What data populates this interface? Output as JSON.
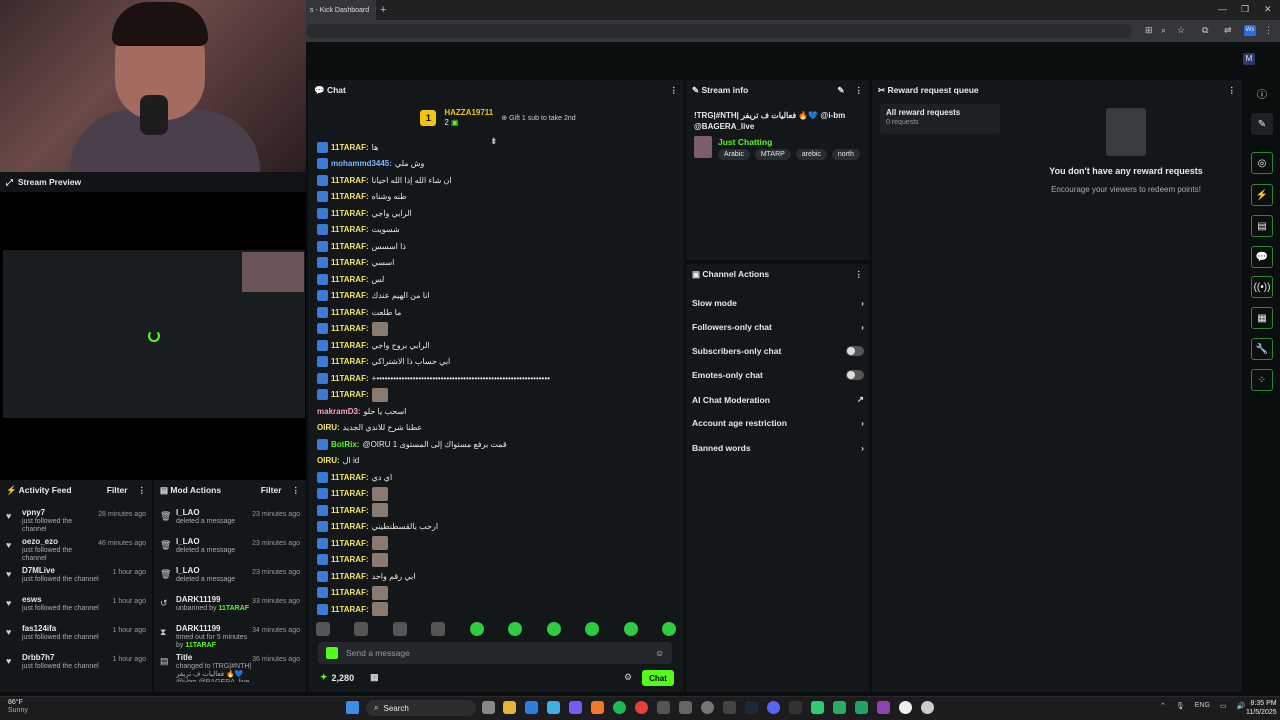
{
  "browser": {
    "tab_title": "s - Kick Dashboard",
    "tab_close": "×",
    "new_tab": "+",
    "window_controls": [
      "—",
      "❐",
      "✕"
    ],
    "profile_initials": "Ws"
  },
  "preview": {
    "title": "Stream Preview"
  },
  "activity_feed": {
    "title": "Activity Feed",
    "filter": "Filter",
    "items": [
      {
        "user": "vpny7",
        "action": "just followed the channel",
        "time": "28 minutes ago"
      },
      {
        "user": "oezo_ezo",
        "action": "just followed the channel",
        "time": "46 minutes ago"
      },
      {
        "user": "D7MLive",
        "action": "just followed the channel",
        "time": "1 hour ago"
      },
      {
        "user": "esws",
        "action": "just followed the channel",
        "time": "1 hour ago"
      },
      {
        "user": "fas124ifa",
        "action": "just followed the channel",
        "time": "1 hour ago"
      },
      {
        "user": "Drbb7h7",
        "action": "just followed the channel",
        "time": "1 hour ago"
      }
    ]
  },
  "mod_actions": {
    "title": "Mod Actions",
    "filter": "Filter",
    "items": [
      {
        "user": "I_LAO",
        "action": "deleted a message",
        "target": "",
        "time": "23 minutes ago"
      },
      {
        "user": "I_LAO",
        "action": "deleted a message",
        "target": "",
        "time": "23 minutes ago"
      },
      {
        "user": "I_LAO",
        "action": "deleted a message",
        "target": "",
        "time": "23 minutes ago"
      },
      {
        "user": "DARK11199",
        "action": "unbanned by ",
        "target": "11TARAF",
        "time": "33 minutes ago"
      },
      {
        "user": "DARK11199",
        "action": "timed out for 5 minutes by ",
        "target": "11TARAF",
        "time": "34 minutes ago"
      },
      {
        "user": "Title",
        "action": "changed to !TRG|#NTH| فعاليات ف تريفر 🔥💙 @i-bm @BAGERA_live by",
        "target": "",
        "time": "36 minutes ago"
      }
    ]
  },
  "chat": {
    "title": "Chat",
    "pinned": {
      "rank": "1",
      "user": "HAZZA19711",
      "count": "2",
      "gift_text": "Gift 1 sub to take 2nd"
    },
    "messages": [
      {
        "user": "11TARAF",
        "text": "ها",
        "color": "yellow"
      },
      {
        "user": "mohammd3445",
        "text": "وش ملي",
        "color": "blue"
      },
      {
        "user": "11TARAF",
        "text": "ان شاء الله إذا الله احيانا",
        "color": "yellow"
      },
      {
        "user": "11TARAF",
        "text": "طنه وشناه",
        "color": "yellow"
      },
      {
        "user": "11TARAF",
        "text": "الرابي واجي",
        "color": "yellow"
      },
      {
        "user": "11TARAF",
        "text": "شسويت",
        "color": "yellow"
      },
      {
        "user": "11TARAF",
        "text": "ذا اسسس",
        "color": "yellow"
      },
      {
        "user": "11TARAF",
        "text": "اسسي",
        "color": "yellow"
      },
      {
        "user": "11TARAF",
        "text": "لس",
        "color": "yellow"
      },
      {
        "user": "11TARAF",
        "text": "انا من الهيم عندك",
        "color": "yellow"
      },
      {
        "user": "11TARAF",
        "text": "ما طلعت",
        "color": "yellow"
      },
      {
        "user": "11TARAF",
        "text": "",
        "color": "yellow",
        "emote": true
      },
      {
        "user": "11TARAF",
        "text": "الرابي بروح واجي",
        "color": "yellow"
      },
      {
        "user": "11TARAF",
        "text": "ابي حساب ذا الاشتراكي",
        "color": "yellow"
      },
      {
        "user": "11TARAF",
        "text": "+••••••••••••••••••••••••••••••••••••••••••••••••••••••••••••••",
        "color": "yellow"
      },
      {
        "user": "11TARAF",
        "text": "",
        "color": "yellow",
        "emote": true
      },
      {
        "user": "makramD3",
        "text": "اسحب يا حلو",
        "color": "pink"
      },
      {
        "user": "OIRU",
        "text": "عطنا شرح للاندي الجديد",
        "color": "yellow"
      },
      {
        "user": "BotRix",
        "text": "@OIRU قمت برفع مستواك إلى المستوى 1",
        "color": "green"
      },
      {
        "user": "OIRU",
        "text": "ال id",
        "color": "yellow"
      },
      {
        "user": "11TARAF",
        "text": "اي دي",
        "color": "yellow"
      },
      {
        "user": "11TARAF",
        "text": "",
        "color": "yellow",
        "emote": true
      },
      {
        "user": "11TARAF",
        "text": "",
        "color": "yellow",
        "emote": true
      },
      {
        "user": "11TARAF",
        "text": "ارحب بالقسطنطيني",
        "color": "yellow"
      },
      {
        "user": "11TARAF",
        "text": "",
        "color": "yellow",
        "emote": true
      },
      {
        "user": "11TARAF",
        "text": "",
        "color": "yellow",
        "emote": true
      },
      {
        "user": "11TARAF",
        "text": "ابي رقم واحد",
        "color": "yellow"
      },
      {
        "user": "11TARAF",
        "text": "",
        "color": "yellow",
        "emote": true
      },
      {
        "user": "11TARAF",
        "text": "",
        "color": "yellow",
        "emote": true
      }
    ],
    "input_placeholder": "Send a message",
    "points": "2,280",
    "send_label": "Chat"
  },
  "stream_info": {
    "title": "Stream info",
    "stream_title": "!TRG|#NTH| فعاليات ف تريفر 🔥💙 @i-bm @BAGERA_live",
    "category": "Just Chatting",
    "tags": [
      "Arabic",
      "MTARP",
      "arebic",
      "north"
    ]
  },
  "channel_actions": {
    "title": "Channel Actions",
    "rows": [
      {
        "label": "Slow mode",
        "kind": "chevron"
      },
      {
        "label": "Followers-only chat",
        "kind": "chevron"
      },
      {
        "label": "Subscribers-only chat",
        "kind": "toggle"
      },
      {
        "label": "Emotes-only chat",
        "kind": "toggle"
      },
      {
        "label": "AI Chat Moderation",
        "kind": "external"
      },
      {
        "label": "Account age restriction",
        "kind": "chevron"
      },
      {
        "label": "Banned words",
        "kind": "chevron"
      }
    ]
  },
  "rewards": {
    "title": "Reward request queue",
    "all_label": "All reward requests",
    "all_count": "0 requests",
    "empty_title": "You don't have any reward requests",
    "empty_sub": "Encourage your viewers to redeem points!"
  },
  "taskbar": {
    "temp": "86°F",
    "weather": "Sunny",
    "search": "Search",
    "lang": "ENG",
    "time": "8:35 PM",
    "date": "11/5/2025"
  },
  "colors": {
    "accent": "#53fc18",
    "bg": "#0b0e0f",
    "panel": "#141719"
  }
}
